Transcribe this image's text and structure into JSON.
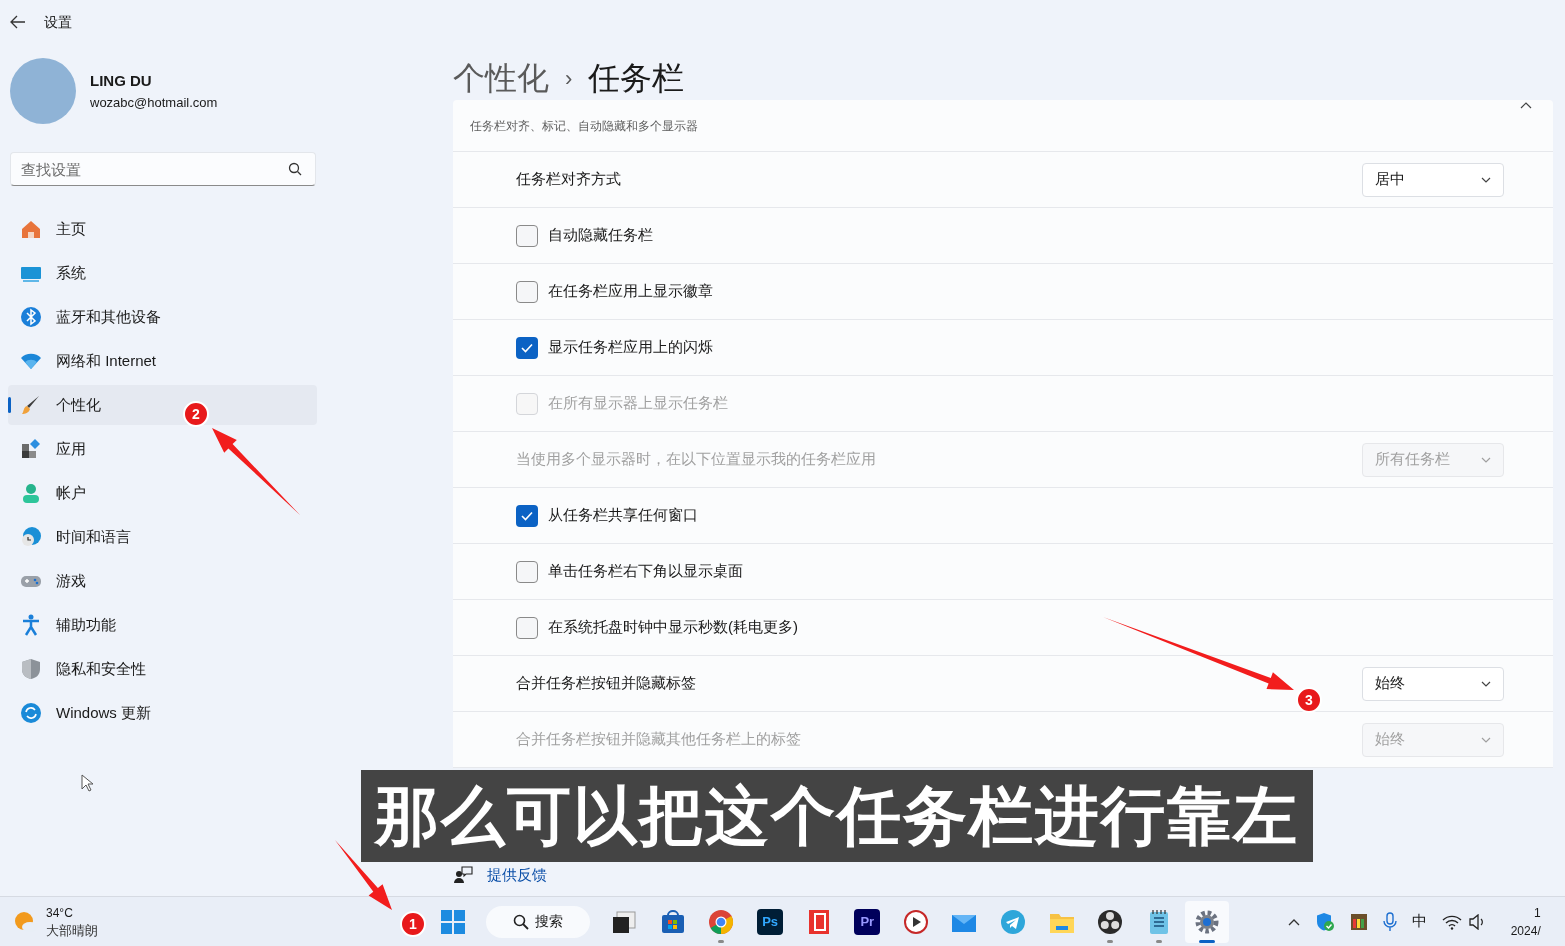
{
  "window": {
    "title": "设置"
  },
  "user": {
    "name": "LING DU",
    "email": "wozabc@hotmail.com"
  },
  "search": {
    "placeholder": "查找设置"
  },
  "sidebar": {
    "items": [
      {
        "kind": "home",
        "label": "主页",
        "selected": false
      },
      {
        "kind": "system",
        "label": "系统",
        "selected": false
      },
      {
        "kind": "bluetooth",
        "label": "蓝牙和其他设备",
        "selected": false
      },
      {
        "kind": "network",
        "label": "网络和 Internet",
        "selected": false
      },
      {
        "kind": "personalize",
        "label": "个性化",
        "selected": true
      },
      {
        "kind": "apps",
        "label": "应用",
        "selected": false
      },
      {
        "kind": "accounts",
        "label": "帐户",
        "selected": false
      },
      {
        "kind": "time",
        "label": "时间和语言",
        "selected": false
      },
      {
        "kind": "gaming",
        "label": "游戏",
        "selected": false
      },
      {
        "kind": "accessibility",
        "label": "辅助功能",
        "selected": false
      },
      {
        "kind": "privacy",
        "label": "隐私和安全性",
        "selected": false
      },
      {
        "kind": "update",
        "label": "Windows 更新",
        "selected": false
      }
    ]
  },
  "breadcrumb": {
    "parent": "个性化",
    "separator": "›",
    "current": "任务栏"
  },
  "section": {
    "description": "任务栏对齐、标记、自动隐藏和多个显示器",
    "expanded": true,
    "rows": [
      {
        "kind": "dropdown",
        "label": "任务栏对齐方式",
        "value": "居中",
        "disabled": false
      },
      {
        "kind": "checkbox",
        "label": "自动隐藏任务栏",
        "checked": false,
        "disabled": false
      },
      {
        "kind": "checkbox",
        "label": "在任务栏应用上显示徽章",
        "checked": false,
        "disabled": false
      },
      {
        "kind": "checkbox",
        "label": "显示任务栏应用上的闪烁",
        "checked": true,
        "disabled": false
      },
      {
        "kind": "checkbox",
        "label": "在所有显示器上显示任务栏",
        "checked": false,
        "disabled": true
      },
      {
        "kind": "dropdown",
        "label": "当使用多个显示器时，在以下位置显示我的任务栏应用",
        "value": "所有任务栏",
        "disabled": true
      },
      {
        "kind": "checkbox",
        "label": "从任务栏共享任何窗口",
        "checked": true,
        "disabled": false
      },
      {
        "kind": "checkbox",
        "label": "单击任务栏右下角以显示桌面",
        "checked": false,
        "disabled": false
      },
      {
        "kind": "checkbox",
        "label": "在系统托盘时钟中显示秒数(耗电更多)",
        "checked": false,
        "disabled": false
      },
      {
        "kind": "dropdown",
        "label": "合并任务栏按钮并隐藏标签",
        "value": "始终",
        "disabled": false
      },
      {
        "kind": "dropdown",
        "label": "合并任务栏按钮并隐藏其他任务栏上的标签",
        "value": "始终",
        "disabled": true
      }
    ]
  },
  "help_links": [
    {
      "label": "提供反馈"
    }
  ],
  "subtitle": "那么可以把这个任务栏进行靠左",
  "annotations": [
    {
      "number": "1"
    },
    {
      "number": "2"
    },
    {
      "number": "3"
    }
  ],
  "taskbar": {
    "weather": {
      "temperature": "34°C",
      "condition": "大部晴朗"
    },
    "search": {
      "label": "搜索"
    },
    "apps": [
      {
        "kind": "taskview",
        "running": false,
        "active": false
      },
      {
        "kind": "store",
        "running": false,
        "active": false
      },
      {
        "kind": "chrome",
        "running": true,
        "active": false
      },
      {
        "kind": "ps",
        "text": "Ps",
        "running": false,
        "active": false
      },
      {
        "kind": "reader",
        "running": false,
        "active": false
      },
      {
        "kind": "pr",
        "text": "Pr",
        "running": false,
        "active": false
      },
      {
        "kind": "player",
        "running": false,
        "active": false
      },
      {
        "kind": "mail",
        "running": false,
        "active": false
      },
      {
        "kind": "telegram",
        "running": false,
        "active": false
      },
      {
        "kind": "folder",
        "running": false,
        "active": false
      },
      {
        "kind": "obs",
        "running": true,
        "active": false
      },
      {
        "kind": "notepad",
        "running": true,
        "active": false
      },
      {
        "kind": "settings",
        "running": true,
        "active": true
      }
    ],
    "tray": {
      "input_method": "中",
      "clock_time": "1",
      "clock_date": "2024/"
    }
  }
}
